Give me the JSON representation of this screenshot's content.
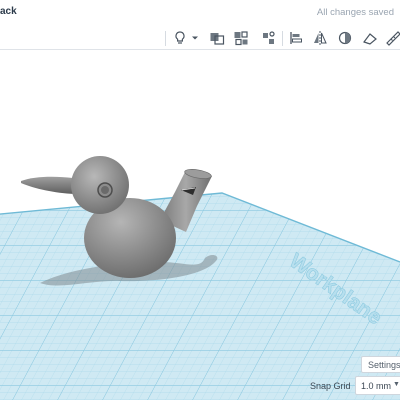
{
  "header": {
    "title": "ack",
    "save_status": "All changes saved"
  },
  "toolbar": {
    "icons": [
      "lightbulb-icon",
      "dropdown-caret-icon",
      "group-icon",
      "ungroup-icon",
      "align-icon",
      "mirror-icon",
      "reflect-icon",
      "workplane-icon",
      "ruler-icon"
    ]
  },
  "viewport": {
    "workplane_label": "Workplane",
    "colors": {
      "grid_fill": "#cfe9f3",
      "grid_line": "#9fd3e6",
      "grid_major": "#7cc2dd",
      "model_gray": "#8a8a8a"
    }
  },
  "footer": {
    "settings_label": "Settings",
    "snap_grid_label": "Snap Grid",
    "snap_grid_value": "1.0 mm"
  }
}
